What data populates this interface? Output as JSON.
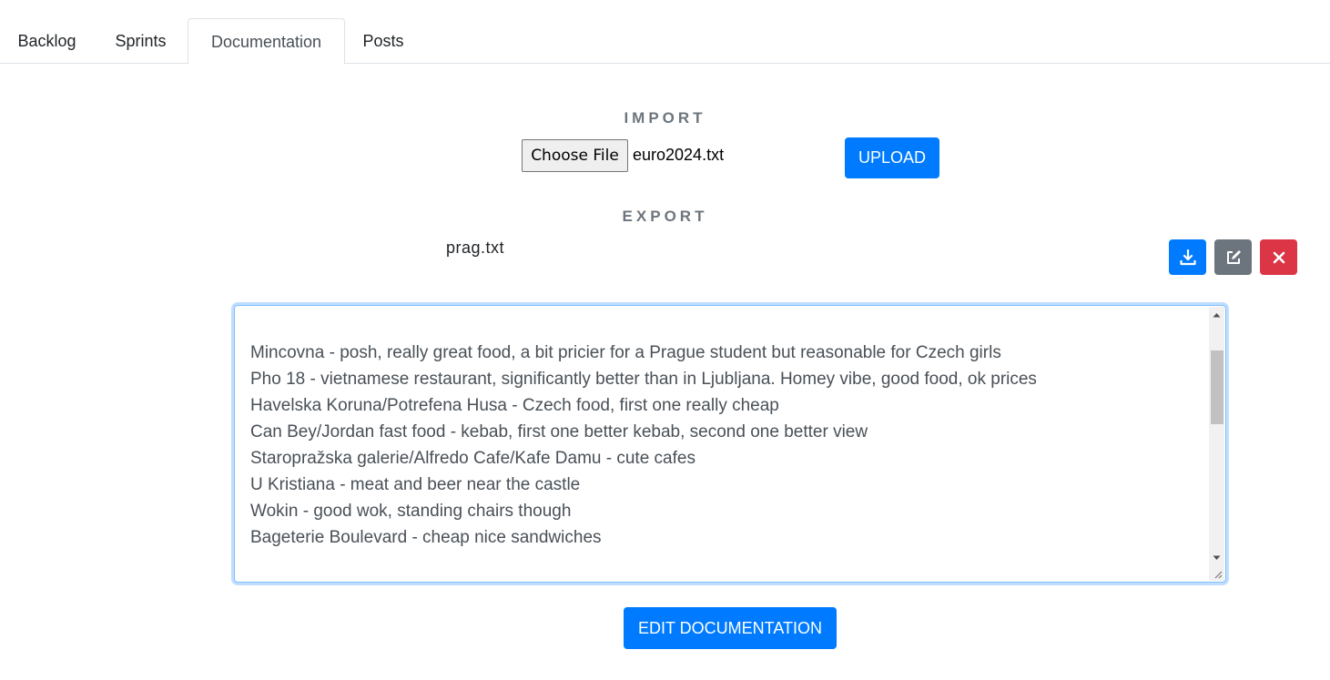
{
  "tabs": [
    {
      "label": "Backlog"
    },
    {
      "label": "Sprints"
    },
    {
      "label": "Documentation",
      "active": true
    },
    {
      "label": "Posts"
    }
  ],
  "import": {
    "title": "IMPORT",
    "choose_file_label": "Choose File",
    "file_name": "euro2024.txt",
    "upload_label": "UPLOAD"
  },
  "export": {
    "title": "EXPORT",
    "file_name": "prag.txt",
    "icons": [
      "download-icon",
      "edit-icon",
      "close-icon"
    ]
  },
  "documentation": {
    "lines": [
      "Mincovna - posh, really great food, a bit pricier for a Prague student but reasonable for Czech girls",
      "Pho 18 - vietnamese restaurant, significantly better than in Ljubljana. Homey vibe, good food, ok prices",
      "Havelska Koruna/Potrefena Husa - Czech food, first one really cheap",
      "Can Bey/Jordan fast food - kebab, first one better kebab, second one better view",
      "Staropražska galerie/Alfredo Cafe/Kafe Damu - cute cafes",
      "U Kristiana - meat and beer near the castle",
      "Wokin - good wok, standing chairs though",
      "Bageterie Boulevard - cheap nice sandwiches"
    ],
    "edit_label": "EDIT DOCUMENTATION"
  },
  "colors": {
    "primary": "#007bff",
    "secondary": "#6c757d",
    "danger": "#dc3545"
  }
}
